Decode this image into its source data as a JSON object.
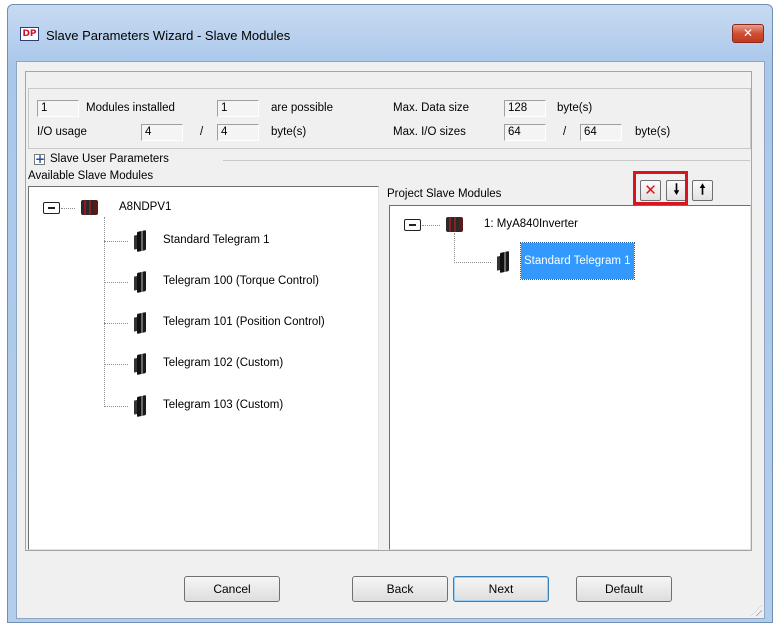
{
  "window": {
    "icon_text": "DP",
    "title": "Slave Parameters Wizard - Slave Modules",
    "close_glyph": "✕"
  },
  "info": {
    "modules_installed_value": "1",
    "modules_installed_label": "Modules installed",
    "possible_value": "1",
    "possible_label": "are possible",
    "max_data_size_label": "Max. Data size",
    "max_data_size_value": "128",
    "max_data_size_unit": "byte(s)",
    "io_usage_label": "I/O usage",
    "io_usage_value": "4",
    "io_usage_sep": "/",
    "io_usage_max": "4",
    "io_usage_unit": "byte(s)",
    "max_io_sizes_label": "Max. I/O sizes",
    "max_io_sizes_value": "64",
    "max_io_sizes_sep": "/",
    "max_io_sizes_max": "64",
    "max_io_sizes_unit": "byte(s)"
  },
  "user_params": {
    "expander_glyph": "+",
    "label": "Slave User Parameters"
  },
  "available": {
    "label": "Available Slave Modules",
    "root": "A8NDPV1",
    "items": [
      "Standard Telegram 1",
      "Telegram 100 (Torque Control)",
      "Telegram 101 (Position Control)",
      "Telegram 102 (Custom)",
      "Telegram 103 (Custom)"
    ]
  },
  "project": {
    "label": "Project Slave Modules",
    "root": "1: MyA840Inverter",
    "items": [
      "Standard Telegram 1"
    ],
    "selected_index": 0,
    "toolbar": {
      "delete_glyph": "✕",
      "down_glyph": "🠗",
      "up_glyph": "🠕"
    }
  },
  "buttons": {
    "cancel": "Cancel",
    "back": "Back",
    "next": "Next",
    "default": "Default"
  },
  "colors": {
    "highlight_box": "#d6151f",
    "selection": "#3399ff",
    "delete_x": "#d6151f"
  }
}
